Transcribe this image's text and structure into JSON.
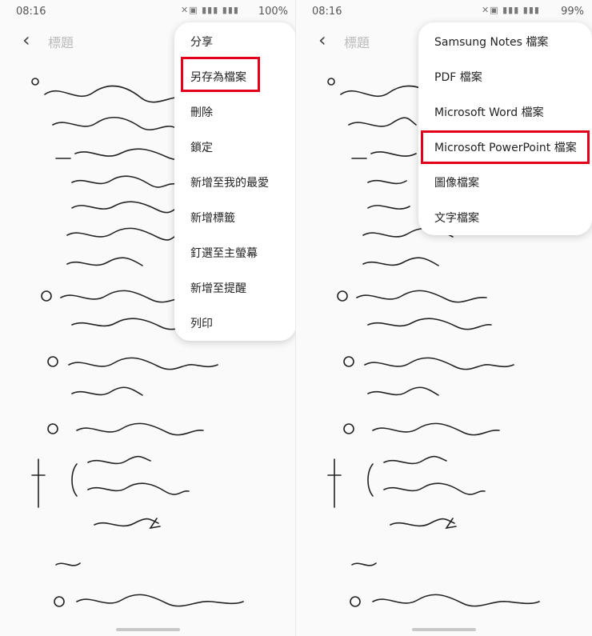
{
  "left": {
    "status_time": "08:16",
    "status_battery": "100%",
    "title_placeholder": "標題",
    "menu": [
      {
        "label": "分享"
      },
      {
        "label": "另存為檔案"
      },
      {
        "label": "刪除"
      },
      {
        "label": "鎖定"
      },
      {
        "label": "新增至我的最愛"
      },
      {
        "label": "新增標籤"
      },
      {
        "label": "釘選至主螢幕"
      },
      {
        "label": "新增至提醒"
      },
      {
        "label": "列印"
      }
    ]
  },
  "right": {
    "status_time": "08:16",
    "status_battery": "99%",
    "title_placeholder": "標題",
    "menu": [
      {
        "label": "Samsung Notes 檔案"
      },
      {
        "label": "PDF 檔案"
      },
      {
        "label": "Microsoft Word 檔案"
      },
      {
        "label": "Microsoft PowerPoint 檔案"
      },
      {
        "label": "圖像檔案"
      },
      {
        "label": "文字檔案"
      }
    ]
  },
  "colors": {
    "highlight": "#e3001b"
  }
}
